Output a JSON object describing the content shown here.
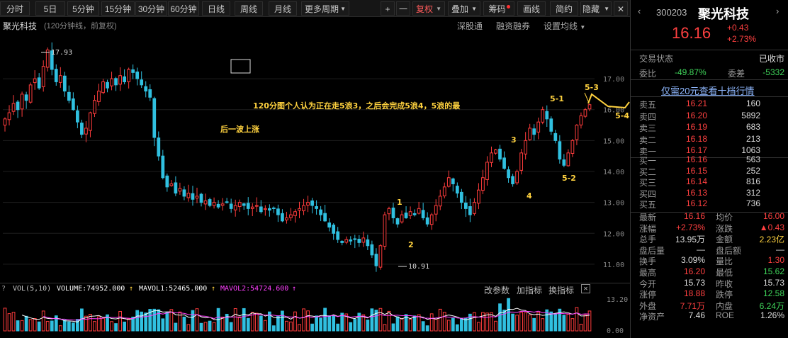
{
  "toolbar": {
    "period_buttons": [
      "分时",
      "5日",
      "5分钟",
      "15分钟",
      "30分钟",
      "60分钟",
      "日线",
      "周线",
      "月线",
      "更多周期"
    ],
    "plus": "+",
    "minus": "一",
    "fuquan": "复权",
    "overlay": "叠加",
    "chips": "筹码",
    "draw": "画线",
    "simple": "简约",
    "hide": "隐藏"
  },
  "chart_header": {
    "stock_name": "聚光科技",
    "subtitle": "(120分钟线，前复权)",
    "links": [
      "深股通",
      "融资融券",
      "设置均线"
    ]
  },
  "annotations": {
    "note_line1": "120分图个人认为正在走5浪3，之后会完成5浪4，5浪的最",
    "note_line2": "后一波上涨",
    "high_label": "17.93",
    "low_label": "10.91",
    "wave_labels": [
      "1",
      "2",
      "3",
      "4",
      "5-1",
      "5-2",
      "5-3",
      "5-4",
      "5"
    ]
  },
  "chart_data": {
    "type": "candlestick",
    "y_ticks": [
      "17.00",
      "16.00",
      "15.00",
      "14.00",
      "13.00",
      "12.00",
      "11.00"
    ],
    "ylim": [
      10.7,
      18.4
    ],
    "high": 17.93,
    "low": 10.91,
    "close": [
      15.7,
      15.9,
      16.2,
      16.0,
      16.5,
      16.3,
      16.8,
      17.0,
      16.7,
      17.4,
      17.93,
      17.3,
      16.9,
      17.1,
      16.6,
      16.3,
      16.0,
      15.6,
      15.2,
      15.4,
      15.9,
      16.3,
      16.6,
      16.9,
      16.7,
      17.0,
      16.8,
      17.1,
      16.9,
      17.3,
      17.2,
      17.0,
      16.8,
      16.6,
      16.4,
      15.1,
      14.5,
      13.8,
      13.5,
      13.6,
      13.3,
      13.45,
      13.2,
      13.3,
      13.1,
      13.2,
      13.0,
      13.05,
      12.9,
      13.0,
      12.85,
      12.95,
      13.0,
      12.8,
      12.9,
      13.0,
      12.9,
      12.8,
      12.85,
      12.9,
      12.7,
      12.8,
      12.75,
      12.8,
      12.6,
      12.4,
      12.5,
      12.6,
      12.7,
      12.8,
      12.9,
      13.0,
      12.9,
      12.8,
      12.6,
      12.4,
      12.2,
      12.0,
      11.8,
      11.7,
      11.8,
      11.75,
      11.8,
      11.7,
      11.85,
      11.6,
      11.3,
      10.95,
      11.6,
      12.6,
      12.8,
      12.5,
      12.3,
      12.6,
      12.5,
      12.7,
      12.6,
      12.8,
      12.5,
      12.3,
      12.6,
      12.9,
      13.2,
      13.5,
      13.8,
      13.6,
      13.3,
      13.0,
      12.8,
      12.6,
      13.0,
      13.4,
      13.8,
      14.3,
      14.6,
      14.7,
      14.4,
      14.1,
      13.8,
      13.6,
      14.0,
      14.6,
      15.0,
      15.4,
      15.2,
      15.6,
      16.0,
      15.7,
      15.3,
      15.0,
      14.4,
      14.2,
      14.6,
      15.0,
      15.5,
      15.8,
      16.0,
      16.16
    ],
    "volume_ticks": [
      "13.20",
      "0.00"
    ],
    "volume_legend": {
      "name": "VOL(5,10)",
      "volume": "VOLUME:74952.000",
      "mavol1": "MAVOL1:52465.000",
      "mavol2": "MAVOL2:54724.600"
    },
    "volume_links": [
      "改参数",
      "加指标",
      "换指标"
    ],
    "colors": {
      "up": "#ff3c3c",
      "down": "#30c0e0",
      "mavol1": "#ffffff",
      "mavol2": "#ff40ff",
      "annotation": "#ffd23f"
    }
  },
  "panel": {
    "code": "300203",
    "name": "聚光科技",
    "price": "16.16",
    "change": "+0.43",
    "change_pct": "+2.73%",
    "status_label": "交易状态",
    "status_value": "已收市",
    "weibi_label": "委比",
    "weibi_value": "-49.87%",
    "weicha_label": "委差",
    "weicha_value": "-5332",
    "promo": "仅需20元查看十档行情",
    "asks": [
      {
        "label": "卖五",
        "price": "16.21",
        "vol": "160"
      },
      {
        "label": "卖四",
        "price": "16.20",
        "vol": "5892"
      },
      {
        "label": "卖三",
        "price": "16.19",
        "vol": "683"
      },
      {
        "label": "卖二",
        "price": "16.18",
        "vol": "213"
      },
      {
        "label": "卖一",
        "price": "16.17",
        "vol": "1063"
      }
    ],
    "bids": [
      {
        "label": "买一",
        "price": "16.16",
        "vol": "563"
      },
      {
        "label": "买二",
        "price": "16.15",
        "vol": "252"
      },
      {
        "label": "买三",
        "price": "16.14",
        "vol": "816"
      },
      {
        "label": "买四",
        "price": "16.13",
        "vol": "312"
      },
      {
        "label": "买五",
        "price": "16.12",
        "vol": "736"
      }
    ],
    "stats": [
      {
        "l1": "最新",
        "v1": "16.16",
        "c1": "up",
        "l2": "均价",
        "v2": "16.00",
        "c2": "up"
      },
      {
        "l1": "涨幅",
        "v1": "+2.73%",
        "c1": "up",
        "l2": "涨跌",
        "v2": "▲0.43",
        "c2": "up"
      },
      {
        "l1": "总手",
        "v1": "13.95万",
        "c1": "wt",
        "l2": "金额",
        "v2": "2.23亿",
        "c2": "ylw"
      },
      {
        "l1": "盘后量",
        "v1": "—",
        "c1": "wt",
        "l2": "盘后额",
        "v2": "—",
        "c2": "wt"
      },
      {
        "l1": "换手",
        "v1": "3.09%",
        "c1": "wt",
        "l2": "量比",
        "v2": "1.30",
        "c2": "up"
      },
      {
        "l1": "最高",
        "v1": "16.20",
        "c1": "up",
        "l2": "最低",
        "v2": "15.62",
        "c2": "dn"
      },
      {
        "l1": "今开",
        "v1": "15.73",
        "c1": "wt",
        "l2": "昨收",
        "v2": "15.73",
        "c2": "wt"
      },
      {
        "l1": "涨停",
        "v1": "18.88",
        "c1": "up",
        "l2": "跌停",
        "v2": "12.58",
        "c2": "dn"
      },
      {
        "l1": "外盘",
        "v1": "7.71万",
        "c1": "up",
        "l2": "内盘",
        "v2": "6.24万",
        "c2": "dn"
      },
      {
        "l1": "净资产",
        "v1": "7.46",
        "c1": "wt",
        "l2": "ROE",
        "v2": "1.26%",
        "c2": "wt"
      }
    ]
  }
}
